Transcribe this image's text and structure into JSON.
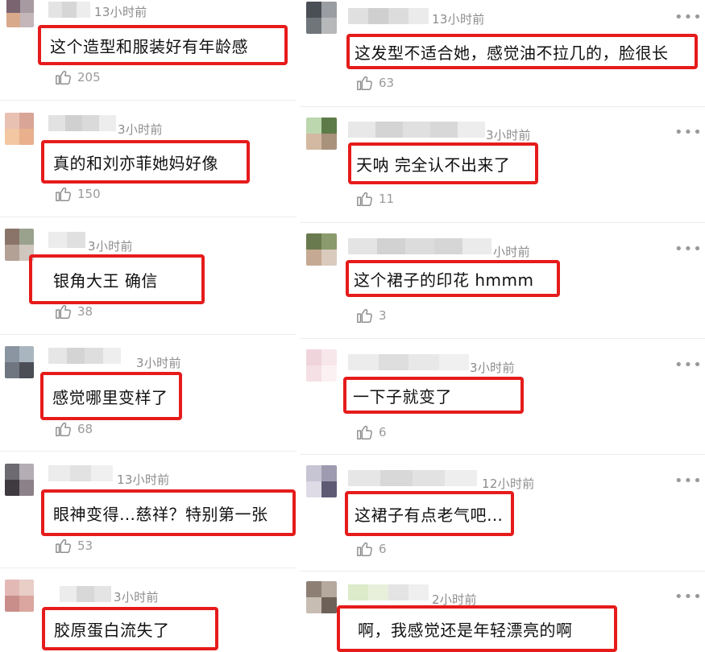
{
  "left": [
    {
      "time": "13小时前",
      "comment": "这个造型和服装好有年龄感",
      "likes": "205"
    },
    {
      "time": "3小时前",
      "comment": "真的和刘亦菲她妈好像",
      "likes": "150"
    },
    {
      "time": "3小时前",
      "comment": "银角大王 确信",
      "likes": "38"
    },
    {
      "time": "3小时前",
      "comment": "感觉哪里变样了",
      "likes": "68"
    },
    {
      "time": "13小时前",
      "comment": "眼神变得…慈祥？特别第一张",
      "likes": "53"
    },
    {
      "time": "3小时前",
      "comment": "胶原蛋白流失了",
      "likes": ""
    }
  ],
  "right": [
    {
      "time": "13小时前",
      "comment": "这发型不适合她，感觉油不拉几的，脸很长",
      "likes": "63"
    },
    {
      "time": "3小时前",
      "comment": "天呐 完全认不出来了",
      "likes": "11"
    },
    {
      "time": "小时前",
      "comment": "这个裙子的印花 hmmm",
      "likes": "3"
    },
    {
      "time": "3小时前",
      "comment": "一下子就变了",
      "likes": "6"
    },
    {
      "time": "12小时前",
      "comment": "这裙子有点老气吧…",
      "likes": "6"
    },
    {
      "time": "2小时前",
      "comment": "啊，我感觉还是年轻漂亮的啊",
      "likes": ""
    }
  ],
  "more_glyph": "•••",
  "icons": {
    "like": "thumbs-up-icon",
    "more": "more-dots-icon"
  },
  "colors": {
    "highlight": "#e61b1b",
    "time": "#8c8c8c",
    "likes": "#9a9a9a"
  }
}
